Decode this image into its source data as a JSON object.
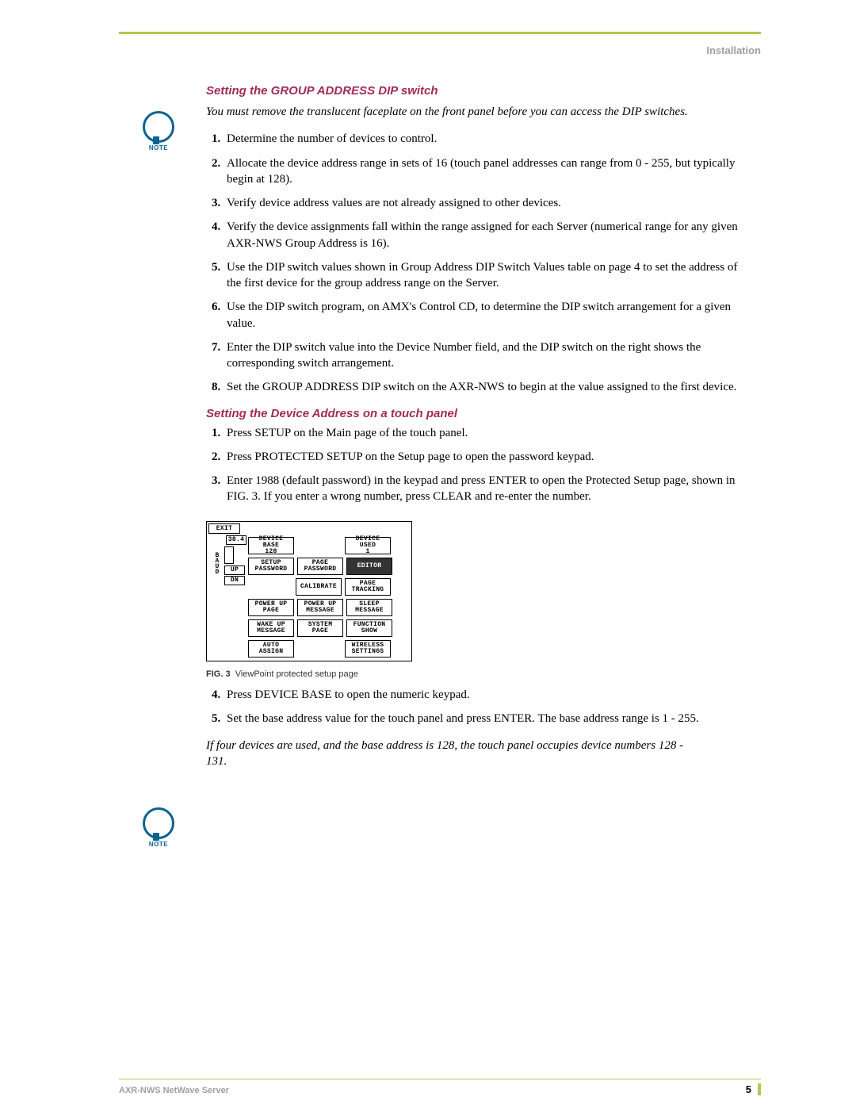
{
  "header": {
    "section": "Installation"
  },
  "sec1": {
    "title": "Setting the GROUP ADDRESS DIP switch",
    "note": "You must remove the translucent faceplate on the front panel before you can access the DIP switches.",
    "steps": [
      "Determine the number of devices to control.",
      "Allocate the device address range in sets of 16 (touch panel addresses can range from 0 - 255, but typically begin at 128).",
      "Verify device address values are not already assigned to other devices.",
      "Verify the device assignments fall within the range assigned for each Server (numerical range for any given AXR-NWS Group Address is 16).",
      "Use the DIP switch values shown in Group Address DIP Switch Values table on page 4 to set the address of the first device for the group address range on the Server.",
      "Use the DIP switch program, on AMX's Control CD, to determine the DIP switch arrangement for a given value.",
      "Enter the DIP switch value into the Device Number field, and the DIP switch on the right shows the corresponding switch arrangement.",
      "Set the GROUP ADDRESS DIP switch on the AXR-NWS to begin at the value assigned to the first device."
    ]
  },
  "sec2": {
    "title": "Setting the Device Address on a touch panel",
    "steps_part1": [
      "Press SETUP on the Main page of the touch panel.",
      "Press PROTECTED SETUP on the Setup page to open the password keypad.",
      "Enter 1988 (default password) in the keypad and press ENTER to open the Protected Setup page, shown in FIG. 3. If you enter a wrong number, press CLEAR and re-enter the number."
    ],
    "steps_part2": [
      "Press DEVICE BASE to open the numeric keypad.",
      "Set the base address value for the touch panel and press ENTER. The base address range is 1 - 255."
    ],
    "note2": "If four devices are used, and the base address is 128, the touch panel occupies device numbers 128 - 131."
  },
  "figure": {
    "caption_prefix": "FIG. 3",
    "caption": "ViewPoint protected setup page",
    "exit": "EXIT",
    "v384": "38.4",
    "baud_letters": [
      "B",
      "A",
      "U",
      "D"
    ],
    "up": "UP",
    "dn": "DN",
    "buttons": {
      "device_base": "DEVICE BASE\n128",
      "device_used": "DEVICE USED\n1",
      "setup_password": "SETUP\nPASSWORD",
      "page_password": "PAGE\nPASSWORD",
      "editor": "EDITOR",
      "calibrate": "CALIBRATE",
      "page_tracking": "PAGE\nTRACKING",
      "power_up_page": "POWER UP\nPAGE",
      "power_up_message": "POWER UP\nMESSAGE",
      "sleep_message": "SLEEP\nMESSAGE",
      "wake_up_message": "WAKE UP\nMESSAGE",
      "system_page": "SYSTEM\nPAGE",
      "function_show": "FUNCTION\nSHOW",
      "auto_assign": "AUTO\nASSIGN",
      "wireless_settings": "WIRELESS\nSETTINGS"
    }
  },
  "footer": {
    "product": "AXR-NWS NetWave Server",
    "page": "5"
  },
  "note_label": "NOTE"
}
